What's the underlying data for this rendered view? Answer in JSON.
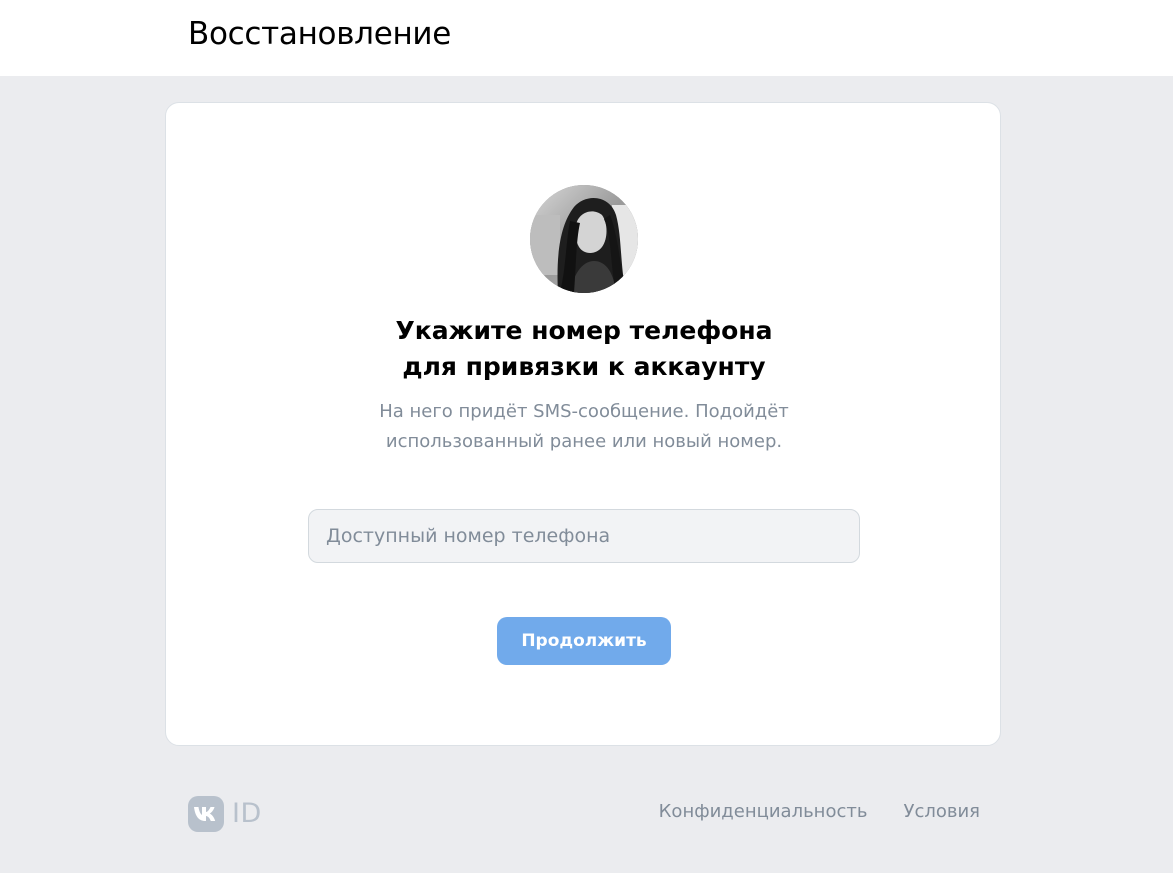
{
  "header": {
    "title": "Восстановление"
  },
  "card": {
    "avatar_icon": "user-avatar-photo",
    "heading_line1": "Укажите номер телефона",
    "heading_line2": "для привязки к аккаунту",
    "subtext_line1": "На него придёт SMS-сообщение. Подойдёт",
    "subtext_line2": "использованный ранее или новый номер.",
    "phone_input": {
      "value": "",
      "placeholder": "Доступный номер телефона"
    },
    "continue_label": "Продолжить"
  },
  "footer": {
    "logo_icon": "vk-logo-icon",
    "logo_text": "ID",
    "links": [
      {
        "label": "Конфиденциальность"
      },
      {
        "label": "Условия"
      }
    ]
  },
  "colors": {
    "page_background": "#ebecef",
    "card_background": "#ffffff",
    "primary_button": "#71aaeb",
    "secondary_text": "#818c99",
    "input_background": "#f2f3f5",
    "logo_gray": "#b8c1cc"
  }
}
